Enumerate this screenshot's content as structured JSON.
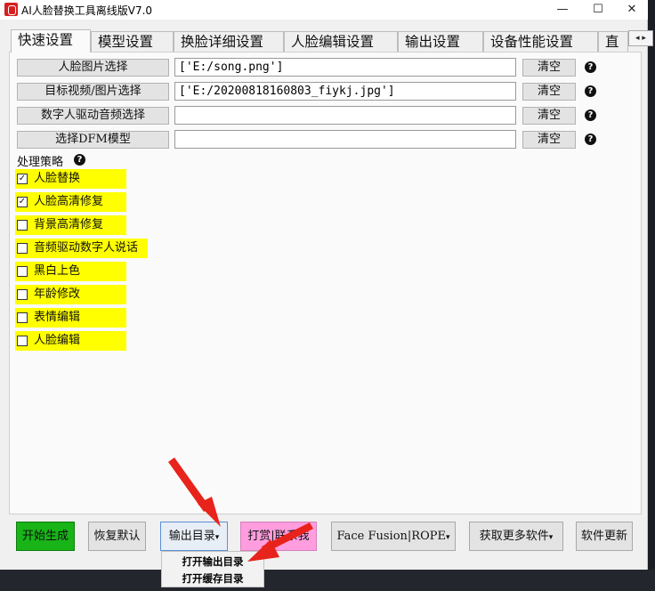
{
  "window": {
    "title": "AI人脸替换工具离线版V7.0",
    "minimize": "—",
    "maximize": "☐",
    "close": "✕"
  },
  "tabs": [
    {
      "label": "快速设置",
      "active": true
    },
    {
      "label": "模型设置",
      "active": false
    },
    {
      "label": "换脸详细设置",
      "active": false
    },
    {
      "label": "人脸编辑设置",
      "active": false
    },
    {
      "label": "输出设置",
      "active": false
    },
    {
      "label": "设备性能设置",
      "active": false
    },
    {
      "label": "直",
      "active": false
    }
  ],
  "tab_scroll": "◂ ▸",
  "rows": [
    {
      "button": "人脸图片选择",
      "value": "['E:/song.png']",
      "clear": "清空"
    },
    {
      "button": "目标视频/图片选择",
      "value": "['E:/20200818160803_fiykj.jpg']",
      "clear": "清空"
    },
    {
      "button": "数字人驱动音频选择",
      "value": "",
      "clear": "清空"
    },
    {
      "button": "选择DFM模型",
      "value": "",
      "clear": "清空"
    }
  ],
  "help_glyph": "?",
  "strategy_label": "处理策略",
  "options": [
    {
      "label": "人脸替换",
      "checked": true
    },
    {
      "label": "人脸高清修复",
      "checked": true
    },
    {
      "label": "背景高清修复",
      "checked": false
    },
    {
      "label": "音频驱动数字人说话",
      "checked": false
    },
    {
      "label": "黑白上色",
      "checked": false
    },
    {
      "label": "年龄修改",
      "checked": false
    },
    {
      "label": "表情编辑",
      "checked": false
    },
    {
      "label": "人脸编辑",
      "checked": false
    }
  ],
  "check_mark": "✓",
  "bottom_buttons": {
    "start": "开始生成",
    "reset": "恢复默认",
    "output_dir": "输出目录",
    "reward": "打赏|联系我",
    "facefusion": "Face Fusion|ROPE",
    "more_software": "获取更多软件",
    "update": "软件更新"
  },
  "caret": "▾",
  "dropdown": [
    "打开输出目录",
    "打开缓存目录"
  ],
  "colors": {
    "highlight": "#ffff00",
    "start": "#18b418",
    "reward": "#ff9dde",
    "arrow": "#e8231b"
  }
}
